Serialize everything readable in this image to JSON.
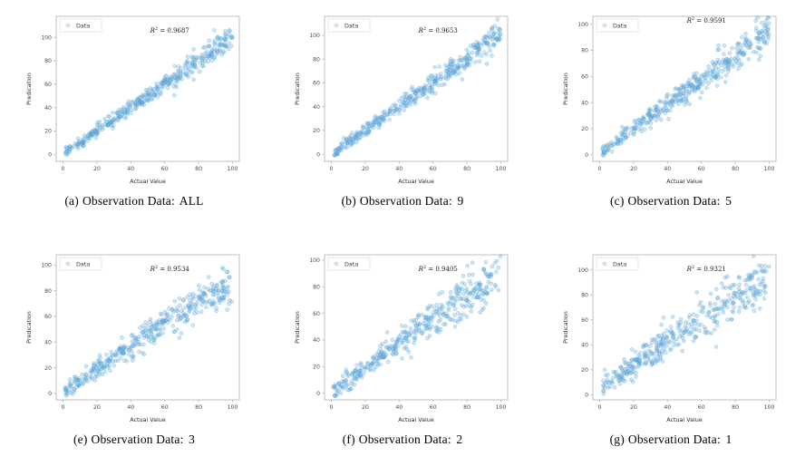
{
  "figure": {
    "rows": 2,
    "cols": 3,
    "background": "#ffffff",
    "marker_color": "#6BAED6",
    "marker_edge_color": "#3B8FD4",
    "spine_color": "#B0B0B0"
  },
  "chart_data": [
    {
      "type": "scatter",
      "panel_id": "a",
      "caption_label": "(a)",
      "caption_text": "Observation  Data:",
      "caption_value": "ALL",
      "title": "",
      "xlabel": "Actual Value",
      "ylabel": "Predication",
      "legend": [
        "Data"
      ],
      "legend_position": "upper left",
      "annotation": "R² = 0.9687",
      "r2_prefix": "R",
      "r2_sup": "2",
      "r2_value": "0.9687",
      "xlim": [
        -4,
        104
      ],
      "ylim": [
        -6,
        118
      ],
      "xticks": [
        0,
        20,
        40,
        60,
        80,
        100
      ],
      "yticks": [
        0,
        20,
        40,
        60,
        80,
        100
      ],
      "grid": false,
      "n_points": 400,
      "noise": 4.0,
      "curve": 0.0,
      "seed": 11
    },
    {
      "type": "scatter",
      "panel_id": "b",
      "caption_label": "(b)",
      "caption_text": "Observation  Data:",
      "caption_value": "9",
      "title": "",
      "xlabel": "Actual Value",
      "ylabel": "Predication",
      "legend": [
        "Data"
      ],
      "legend_position": "upper left",
      "annotation": "R² = 0.9653",
      "r2_prefix": "R",
      "r2_sup": "2",
      "r2_value": "0.9653",
      "xlim": [
        -4,
        104
      ],
      "ylim": [
        -6,
        116
      ],
      "xticks": [
        0,
        20,
        40,
        60,
        80,
        100
      ],
      "yticks": [
        0,
        20,
        40,
        60,
        80,
        100
      ],
      "grid": false,
      "n_points": 400,
      "noise": 4.4,
      "curve": 0.0,
      "seed": 23
    },
    {
      "type": "scatter",
      "panel_id": "c",
      "caption_label": "(c)",
      "caption_text": "Observation  Data:",
      "caption_value": "5",
      "title": "",
      "xlabel": "Actual Value",
      "ylabel": "Predication",
      "legend": [
        "Data"
      ],
      "legend_position": "upper left",
      "annotation": "R² = 0.9591",
      "r2_prefix": "R",
      "r2_sup": "2",
      "r2_value": "0.9591",
      "xlim": [
        -4,
        104
      ],
      "ylim": [
        -5,
        106
      ],
      "xticks": [
        0,
        20,
        40,
        60,
        80,
        100
      ],
      "yticks": [
        0,
        20,
        40,
        60,
        80,
        100
      ],
      "grid": false,
      "n_points": 400,
      "noise": 5.2,
      "curve": -0.0006,
      "seed": 37
    },
    {
      "type": "scatter",
      "panel_id": "e",
      "caption_label": "(e)",
      "caption_text": "Observation  Data:",
      "caption_value": "3",
      "title": "",
      "xlabel": "Actual Value",
      "ylabel": "Predication",
      "legend": [
        "Data"
      ],
      "legend_position": "upper left",
      "annotation": "R² = 0.9534",
      "r2_prefix": "R",
      "r2_sup": "2",
      "r2_value": "0.9534",
      "xlim": [
        -4,
        104
      ],
      "ylim": [
        -5,
        108
      ],
      "xticks": [
        0,
        20,
        40,
        60,
        80,
        100
      ],
      "yticks": [
        0,
        20,
        40,
        60,
        80,
        100
      ],
      "grid": false,
      "n_points": 400,
      "noise": 6.0,
      "curve": -0.0016,
      "seed": 53
    },
    {
      "type": "scatter",
      "panel_id": "f",
      "caption_label": "(f)",
      "caption_text": "Observation  Data:",
      "caption_value": "2",
      "title": "",
      "xlabel": "Actual Value",
      "ylabel": "Predication",
      "legend": [
        "Data"
      ],
      "legend_position": "upper left",
      "annotation": "R² = 0.9405",
      "r2_prefix": "R",
      "r2_sup": "2",
      "r2_value": "0.9405",
      "xlim": [
        -4,
        104
      ],
      "ylim": [
        -5,
        104
      ],
      "xticks": [
        0,
        20,
        40,
        60,
        80,
        100
      ],
      "yticks": [
        0,
        20,
        40,
        60,
        80,
        100
      ],
      "grid": false,
      "n_points": 400,
      "noise": 7.0,
      "curve": -0.0012,
      "seed": 71
    },
    {
      "type": "scatter",
      "panel_id": "g",
      "caption_label": "(g)",
      "caption_text": "Observation  Data:",
      "caption_value": "1",
      "title": "",
      "xlabel": "Actual Value",
      "ylabel": "Predication",
      "legend": [
        "Data"
      ],
      "legend_position": "upper left",
      "annotation": "R² = 0.9321",
      "r2_prefix": "R",
      "r2_sup": "2",
      "r2_value": "0.9321",
      "xlim": [
        -4,
        104
      ],
      "ylim": [
        -4,
        112
      ],
      "xticks": [
        0,
        20,
        40,
        60,
        80,
        100
      ],
      "yticks": [
        0,
        20,
        40,
        60,
        80,
        100
      ],
      "grid": false,
      "n_points": 400,
      "noise": 8.2,
      "curve": -0.001,
      "offset": 4,
      "seed": 97
    }
  ]
}
